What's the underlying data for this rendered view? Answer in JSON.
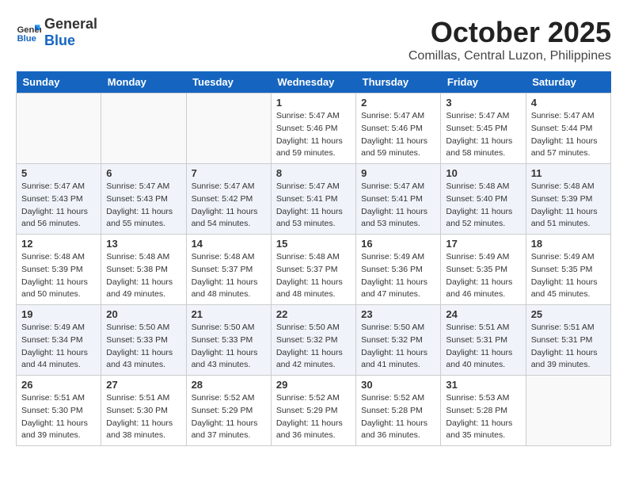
{
  "logo": {
    "line1": "General",
    "line2": "Blue"
  },
  "title": "October 2025",
  "subtitle": "Comillas, Central Luzon, Philippines",
  "weekdays": [
    "Sunday",
    "Monday",
    "Tuesday",
    "Wednesday",
    "Thursday",
    "Friday",
    "Saturday"
  ],
  "weeks": [
    [
      {
        "day": "",
        "info": ""
      },
      {
        "day": "",
        "info": ""
      },
      {
        "day": "",
        "info": ""
      },
      {
        "day": "1",
        "info": "Sunrise: 5:47 AM\nSunset: 5:46 PM\nDaylight: 11 hours\nand 59 minutes."
      },
      {
        "day": "2",
        "info": "Sunrise: 5:47 AM\nSunset: 5:46 PM\nDaylight: 11 hours\nand 59 minutes."
      },
      {
        "day": "3",
        "info": "Sunrise: 5:47 AM\nSunset: 5:45 PM\nDaylight: 11 hours\nand 58 minutes."
      },
      {
        "day": "4",
        "info": "Sunrise: 5:47 AM\nSunset: 5:44 PM\nDaylight: 11 hours\nand 57 minutes."
      }
    ],
    [
      {
        "day": "5",
        "info": "Sunrise: 5:47 AM\nSunset: 5:43 PM\nDaylight: 11 hours\nand 56 minutes."
      },
      {
        "day": "6",
        "info": "Sunrise: 5:47 AM\nSunset: 5:43 PM\nDaylight: 11 hours\nand 55 minutes."
      },
      {
        "day": "7",
        "info": "Sunrise: 5:47 AM\nSunset: 5:42 PM\nDaylight: 11 hours\nand 54 minutes."
      },
      {
        "day": "8",
        "info": "Sunrise: 5:47 AM\nSunset: 5:41 PM\nDaylight: 11 hours\nand 53 minutes."
      },
      {
        "day": "9",
        "info": "Sunrise: 5:47 AM\nSunset: 5:41 PM\nDaylight: 11 hours\nand 53 minutes."
      },
      {
        "day": "10",
        "info": "Sunrise: 5:48 AM\nSunset: 5:40 PM\nDaylight: 11 hours\nand 52 minutes."
      },
      {
        "day": "11",
        "info": "Sunrise: 5:48 AM\nSunset: 5:39 PM\nDaylight: 11 hours\nand 51 minutes."
      }
    ],
    [
      {
        "day": "12",
        "info": "Sunrise: 5:48 AM\nSunset: 5:39 PM\nDaylight: 11 hours\nand 50 minutes."
      },
      {
        "day": "13",
        "info": "Sunrise: 5:48 AM\nSunset: 5:38 PM\nDaylight: 11 hours\nand 49 minutes."
      },
      {
        "day": "14",
        "info": "Sunrise: 5:48 AM\nSunset: 5:37 PM\nDaylight: 11 hours\nand 48 minutes."
      },
      {
        "day": "15",
        "info": "Sunrise: 5:48 AM\nSunset: 5:37 PM\nDaylight: 11 hours\nand 48 minutes."
      },
      {
        "day": "16",
        "info": "Sunrise: 5:49 AM\nSunset: 5:36 PM\nDaylight: 11 hours\nand 47 minutes."
      },
      {
        "day": "17",
        "info": "Sunrise: 5:49 AM\nSunset: 5:35 PM\nDaylight: 11 hours\nand 46 minutes."
      },
      {
        "day": "18",
        "info": "Sunrise: 5:49 AM\nSunset: 5:35 PM\nDaylight: 11 hours\nand 45 minutes."
      }
    ],
    [
      {
        "day": "19",
        "info": "Sunrise: 5:49 AM\nSunset: 5:34 PM\nDaylight: 11 hours\nand 44 minutes."
      },
      {
        "day": "20",
        "info": "Sunrise: 5:50 AM\nSunset: 5:33 PM\nDaylight: 11 hours\nand 43 minutes."
      },
      {
        "day": "21",
        "info": "Sunrise: 5:50 AM\nSunset: 5:33 PM\nDaylight: 11 hours\nand 43 minutes."
      },
      {
        "day": "22",
        "info": "Sunrise: 5:50 AM\nSunset: 5:32 PM\nDaylight: 11 hours\nand 42 minutes."
      },
      {
        "day": "23",
        "info": "Sunrise: 5:50 AM\nSunset: 5:32 PM\nDaylight: 11 hours\nand 41 minutes."
      },
      {
        "day": "24",
        "info": "Sunrise: 5:51 AM\nSunset: 5:31 PM\nDaylight: 11 hours\nand 40 minutes."
      },
      {
        "day": "25",
        "info": "Sunrise: 5:51 AM\nSunset: 5:31 PM\nDaylight: 11 hours\nand 39 minutes."
      }
    ],
    [
      {
        "day": "26",
        "info": "Sunrise: 5:51 AM\nSunset: 5:30 PM\nDaylight: 11 hours\nand 39 minutes."
      },
      {
        "day": "27",
        "info": "Sunrise: 5:51 AM\nSunset: 5:30 PM\nDaylight: 11 hours\nand 38 minutes."
      },
      {
        "day": "28",
        "info": "Sunrise: 5:52 AM\nSunset: 5:29 PM\nDaylight: 11 hours\nand 37 minutes."
      },
      {
        "day": "29",
        "info": "Sunrise: 5:52 AM\nSunset: 5:29 PM\nDaylight: 11 hours\nand 36 minutes."
      },
      {
        "day": "30",
        "info": "Sunrise: 5:52 AM\nSunset: 5:28 PM\nDaylight: 11 hours\nand 36 minutes."
      },
      {
        "day": "31",
        "info": "Sunrise: 5:53 AM\nSunset: 5:28 PM\nDaylight: 11 hours\nand 35 minutes."
      },
      {
        "day": "",
        "info": ""
      }
    ]
  ]
}
